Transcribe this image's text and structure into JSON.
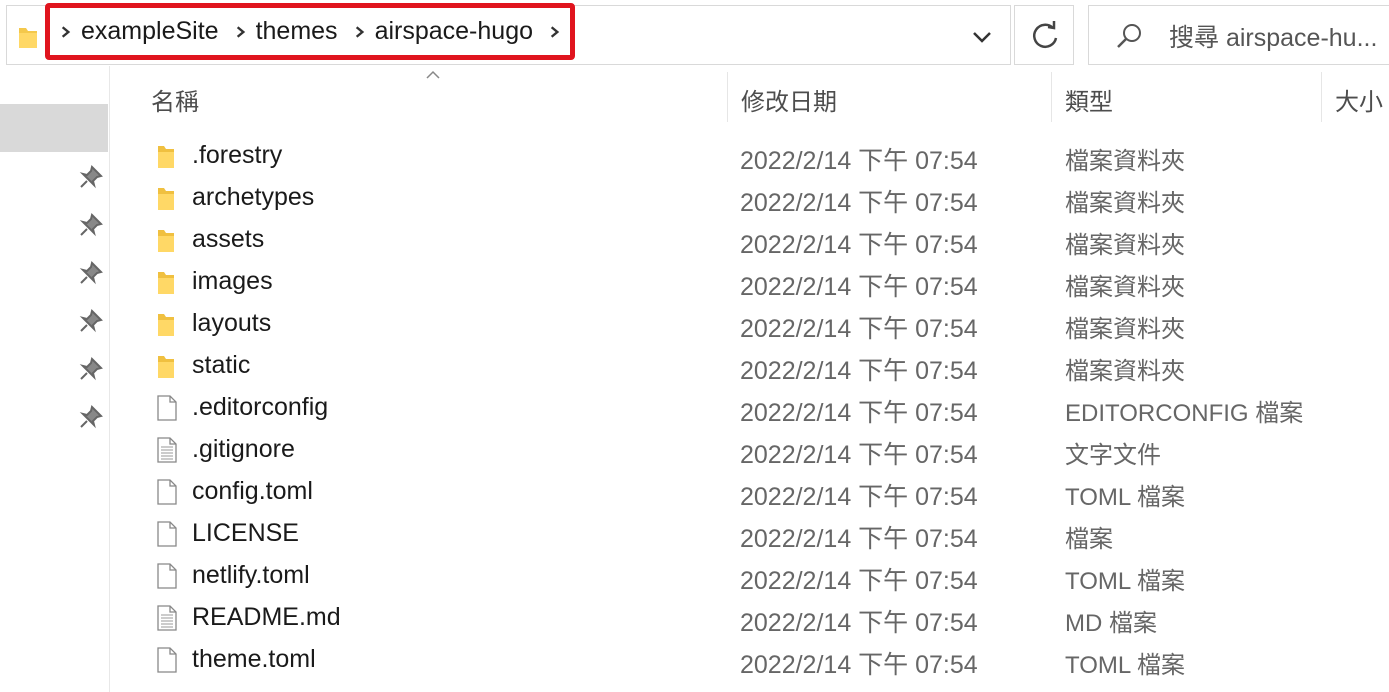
{
  "address": {
    "breadcrumbs": [
      "exampleSite",
      "themes",
      "airspace-hugo"
    ],
    "search_placeholder": "搜尋 airspace-hu..."
  },
  "columns": {
    "name": "名稱",
    "date": "修改日期",
    "type": "類型",
    "size": "大小"
  },
  "files": [
    {
      "name": ".forestry",
      "date": "2022/2/14 下午 07:54",
      "type": "檔案資料夾",
      "icon": "folder-icon"
    },
    {
      "name": "archetypes",
      "date": "2022/2/14 下午 07:54",
      "type": "檔案資料夾",
      "icon": "folder-icon"
    },
    {
      "name": "assets",
      "date": "2022/2/14 下午 07:54",
      "type": "檔案資料夾",
      "icon": "folder-icon"
    },
    {
      "name": "images",
      "date": "2022/2/14 下午 07:54",
      "type": "檔案資料夾",
      "icon": "folder-icon"
    },
    {
      "name": "layouts",
      "date": "2022/2/14 下午 07:54",
      "type": "檔案資料夾",
      "icon": "folder-icon"
    },
    {
      "name": "static",
      "date": "2022/2/14 下午 07:54",
      "type": "檔案資料夾",
      "icon": "folder-icon"
    },
    {
      "name": ".editorconfig",
      "date": "2022/2/14 下午 07:54",
      "type": "EDITORCONFIG 檔案",
      "icon": "file-icon"
    },
    {
      "name": ".gitignore",
      "date": "2022/2/14 下午 07:54",
      "type": "文字文件",
      "icon": "text-file-icon"
    },
    {
      "name": "config.toml",
      "date": "2022/2/14 下午 07:54",
      "type": "TOML 檔案",
      "icon": "file-icon"
    },
    {
      "name": "LICENSE",
      "date": "2022/2/14 下午 07:54",
      "type": "檔案",
      "icon": "file-icon"
    },
    {
      "name": "netlify.toml",
      "date": "2022/2/14 下午 07:54",
      "type": "TOML 檔案",
      "icon": "file-icon"
    },
    {
      "name": "README.md",
      "date": "2022/2/14 下午 07:54",
      "type": "MD 檔案",
      "icon": "text-file-icon"
    },
    {
      "name": "theme.toml",
      "date": "2022/2/14 下午 07:54",
      "type": "TOML 檔案",
      "icon": "file-icon"
    }
  ],
  "highlight_color": "#e0141e"
}
